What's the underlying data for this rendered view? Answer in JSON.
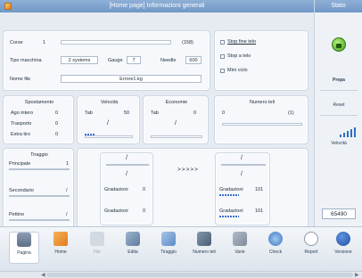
{
  "title": "[Home page] Informazioni generali",
  "stato_label": "Stato",
  "info": {
    "corse_label": "Corse",
    "corse_value": "1",
    "corse_count": "(158)",
    "tipo_label": "Tipo macchina",
    "tipo_value": "2 systems",
    "gauge_label": "Gauge",
    "gauge_value": "7",
    "needle_label": "Needle",
    "needle_value": "600",
    "nome_label": "Nome file",
    "nome_value": "Errore1.kg",
    "opt1": "Stop fine telo",
    "opt2": "Stop a telo",
    "opt3": "Mini ciclo"
  },
  "spostamento": {
    "title": "Spostamento",
    "r1_label": "Ago intero",
    "r1_value": "0",
    "r2_label": "Trasporto",
    "r2_value": "0",
    "r3_label": "Extra tiro",
    "r3_value": "0"
  },
  "velocita": {
    "title": "Velocità",
    "tab_label": "Tab",
    "tab_value": "50",
    "slash": "/"
  },
  "economie": {
    "title": "Economie",
    "tab_label": "Tab",
    "tab_value": "0",
    "slash": "/"
  },
  "numero_teli": {
    "title": "Numero teli",
    "left": "0",
    "right": "(1)"
  },
  "tiraggio": {
    "title": "Tiraggio",
    "principale_label": "Principale",
    "principale_value": "1",
    "secondario_label": "Secondario",
    "secondario_value": "/",
    "pettine_label": "Pettine",
    "pettine_value": "/"
  },
  "gradazioni_left": {
    "top_slash": "/",
    "mid_slash": "/",
    "g1_label": "Gradazioni",
    "g1_value": "0",
    "g2_label": "Gradazioni",
    "g2_value": "0"
  },
  "arrows": ">>>>>",
  "gradazioni_right": {
    "top_slash": "/",
    "mid_slash": "/",
    "g1_label": "Gradazioni",
    "g1_value": "101",
    "g2_label": "Gradazioni",
    "g2_value": "101"
  },
  "right_panel": {
    "prep": "Prepa",
    "reset": "Reset",
    "velocita": "Velocità",
    "counter": "65490"
  },
  "toolbar": [
    {
      "label": "Pagina",
      "icon": "page-icon",
      "color": "#5d6f86"
    },
    {
      "label": "Home",
      "icon": "home-icon",
      "color": "#e98a2b"
    },
    {
      "label": "File",
      "icon": "file-icon",
      "color": "#c9d1da"
    },
    {
      "label": "Edita",
      "icon": "edit-icon",
      "color": "#6a87a8"
    },
    {
      "label": "Tiraggio",
      "icon": "tension-icon",
      "color": "#6b95c9"
    },
    {
      "label": "Numero teli",
      "icon": "count-icon",
      "color": "#5b6e86"
    },
    {
      "label": "Varie",
      "icon": "misc-icon",
      "color": "#8b98a8"
    },
    {
      "label": "Check",
      "icon": "check-icon",
      "color": "#4e86c9"
    },
    {
      "label": "Report",
      "icon": "report-icon",
      "color": "#8a97a6"
    },
    {
      "label": "Versione",
      "icon": "info-icon",
      "color": "#2b62b7"
    }
  ]
}
